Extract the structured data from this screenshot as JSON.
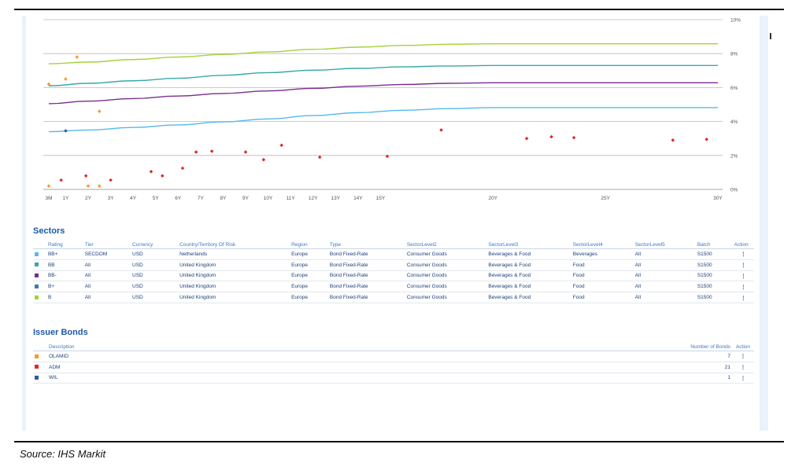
{
  "chart_data": {
    "type": "line",
    "x_ticks": [
      "3M",
      "1Y",
      "2Y",
      "3Y",
      "4Y",
      "5Y",
      "6Y",
      "7Y",
      "8Y",
      "9Y",
      "10Y",
      "11Y",
      "12Y",
      "13Y",
      "14Y",
      "15Y",
      "20Y",
      "25Y",
      "30Y"
    ],
    "x_tick_years": [
      0.25,
      1,
      2,
      3,
      4,
      5,
      6,
      7,
      8,
      9,
      10,
      11,
      12,
      13,
      14,
      15,
      20,
      25,
      30
    ],
    "y_ticks": [
      "0%",
      "2%",
      "4%",
      "6%",
      "8%",
      "10%"
    ],
    "ylim": [
      0,
      10
    ],
    "xlim": [
      0.25,
      30
    ],
    "grid": true,
    "series": [
      {
        "color": "#a6d13a",
        "x": [
          0.25,
          2,
          4,
          6,
          8,
          10,
          12,
          14,
          16,
          18,
          20,
          25,
          30
        ],
        "y": [
          7.4,
          7.5,
          7.65,
          7.8,
          7.95,
          8.1,
          8.25,
          8.38,
          8.48,
          8.55,
          8.58,
          8.58,
          8.58
        ]
      },
      {
        "color": "#3aa8a8",
        "x": [
          0.25,
          2,
          4,
          6,
          8,
          10,
          12,
          14,
          16,
          18,
          20,
          25,
          30
        ],
        "y": [
          6.1,
          6.25,
          6.4,
          6.55,
          6.72,
          6.88,
          7.02,
          7.13,
          7.22,
          7.27,
          7.3,
          7.3,
          7.3
        ]
      },
      {
        "color": "#7a2d8e",
        "x": [
          0.25,
          2,
          4,
          6,
          8,
          10,
          12,
          14,
          16,
          18,
          20,
          25,
          30
        ],
        "y": [
          5.05,
          5.2,
          5.35,
          5.5,
          5.65,
          5.8,
          5.95,
          6.08,
          6.18,
          6.25,
          6.28,
          6.28,
          6.28
        ]
      },
      {
        "color": "#55b9ea",
        "x": [
          0.25,
          2,
          4,
          6,
          8,
          10,
          12,
          14,
          16,
          18,
          20,
          25,
          30
        ],
        "y": [
          3.4,
          3.5,
          3.65,
          3.8,
          3.98,
          4.15,
          4.35,
          4.52,
          4.66,
          4.76,
          4.82,
          4.82,
          4.82
        ]
      }
    ],
    "points": [
      {
        "group": "OLAMID",
        "color": "#f39a2b",
        "x": [
          0.25,
          1,
          1.5,
          2.5,
          2,
          2.5,
          0.25
        ],
        "y": [
          6.2,
          6.5,
          7.8,
          4.6,
          0.2,
          0.2,
          0.2
        ]
      },
      {
        "group": "ADM",
        "color": "#e3262e",
        "x": [
          0.8,
          1.9,
          3,
          4.8,
          5.3,
          6.2,
          6.8,
          7.5,
          9,
          9.8,
          10.6,
          12.3,
          15.3,
          17.7,
          21.5,
          22.6,
          23.6,
          28,
          29.5
        ],
        "y": [
          0.55,
          0.8,
          0.55,
          1.05,
          0.8,
          1.25,
          2.2,
          2.25,
          2.2,
          1.75,
          2.6,
          1.9,
          1.95,
          3.5,
          3.0,
          3.1,
          3.05,
          2.9,
          2.95
        ]
      },
      {
        "group": "WIL",
        "color": "#2d5ba8",
        "x": [
          1
        ],
        "y": [
          3.45
        ]
      }
    ]
  },
  "sectors": {
    "title": "Sectors",
    "columns": [
      "Rating",
      "Tier",
      "Currency",
      "Country/Territory Of Risk",
      "Region",
      "Type",
      "SectorLevel2",
      "SectorLevel3",
      "SectorLevel4",
      "SectorLevel5",
      "Batch",
      "Action"
    ],
    "rows": [
      {
        "color": "#55b9ea",
        "cells": [
          "BB+",
          "SECDOM",
          "USD",
          "Netherlands",
          "Europe",
          "Bond Fixed-Rate",
          "Consumer Goods",
          "Beverages & Food",
          "Beverages",
          "All",
          "S1500"
        ]
      },
      {
        "color": "#3aa8a8",
        "cells": [
          "BB",
          "All",
          "USD",
          "United Kingdom",
          "Europe",
          "Bond Fixed-Rate",
          "Consumer Goods",
          "Beverages & Food",
          "Food",
          "All",
          "S1500"
        ]
      },
      {
        "color": "#7a2d8e",
        "cells": [
          "BB-",
          "All",
          "USD",
          "United Kingdom",
          "Europe",
          "Bond Fixed-Rate",
          "Consumer Goods",
          "Beverages & Food",
          "Food",
          "All",
          "S1500"
        ]
      },
      {
        "color": "#3a7ea8",
        "cells": [
          "B+",
          "All",
          "USD",
          "United Kingdom",
          "Europe",
          "Bond Fixed-Rate",
          "Consumer Goods",
          "Beverages & Food",
          "Food",
          "All",
          "S1500"
        ]
      },
      {
        "color": "#a6d13a",
        "cells": [
          "B",
          "All",
          "USD",
          "United Kingdom",
          "Europe",
          "Bond Fixed-Rate",
          "Consumer Goods",
          "Beverages & Food",
          "Food",
          "All",
          "S1500"
        ]
      }
    ],
    "action_glyph": "⋮"
  },
  "issuer_bonds": {
    "title": "Issuer Bonds",
    "columns": [
      "Description",
      "Number of Bonds",
      "Action"
    ],
    "rows": [
      {
        "color": "#f39a2b",
        "name": "OLAMID",
        "count": "7"
      },
      {
        "color": "#e3262e",
        "name": "ADM",
        "count": "21"
      },
      {
        "color": "#2d5ba8",
        "name": "WIL",
        "count": "1"
      }
    ],
    "action_glyph": "⋮"
  },
  "source": "Source: IHS Markit"
}
